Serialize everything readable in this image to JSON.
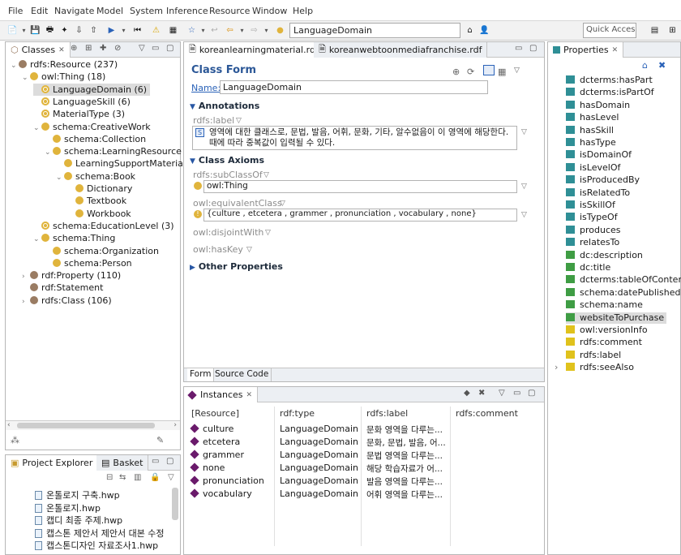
{
  "menu": [
    "File",
    "Edit",
    "Navigate",
    "Model",
    "System",
    "Inference",
    "Resource",
    "Window",
    "Help"
  ],
  "toolbar": {
    "current_resource": "LanguageDomain",
    "quick_access": "Quick Access"
  },
  "classes": {
    "tab": "Classes",
    "tree": [
      {
        "label": "rdfs:Resource  (237)",
        "indent": 0,
        "twisty": "v",
        "icon": "brown"
      },
      {
        "label": "owl:Thing  (18)",
        "indent": 1,
        "twisty": "v",
        "icon": "yellow"
      },
      {
        "label": "LanguageDomain  (6)",
        "indent": 2,
        "twisty": "",
        "icon": "ring",
        "selected": true
      },
      {
        "label": "LanguageSkill  (6)",
        "indent": 2,
        "twisty": "",
        "icon": "ring"
      },
      {
        "label": "MaterialType  (3)",
        "indent": 2,
        "twisty": "",
        "icon": "ring"
      },
      {
        "label": "schema:CreativeWork",
        "indent": 2,
        "twisty": "v",
        "icon": "yellow"
      },
      {
        "label": "schema:Collection",
        "indent": 3,
        "twisty": "",
        "icon": "yellow"
      },
      {
        "label": "schema:LearningResource",
        "indent": 3,
        "twisty": "v",
        "icon": "yellow"
      },
      {
        "label": "LearningSupportMaterial",
        "indent": 4,
        "twisty": "",
        "icon": "yellow"
      },
      {
        "label": "schema:Book",
        "indent": 4,
        "twisty": "v",
        "icon": "yellow"
      },
      {
        "label": "Dictionary",
        "indent": 5,
        "twisty": "",
        "icon": "yellow"
      },
      {
        "label": "Textbook",
        "indent": 5,
        "twisty": "",
        "icon": "yellow"
      },
      {
        "label": "Workbook",
        "indent": 5,
        "twisty": "",
        "icon": "yellow"
      },
      {
        "label": "schema:EducationLevel  (3)",
        "indent": 2,
        "twisty": "",
        "icon": "ring"
      },
      {
        "label": "schema:Thing",
        "indent": 2,
        "twisty": "v",
        "icon": "yellow"
      },
      {
        "label": "schema:Organization",
        "indent": 3,
        "twisty": "",
        "icon": "yellow"
      },
      {
        "label": "schema:Person",
        "indent": 3,
        "twisty": "",
        "icon": "yellow"
      },
      {
        "label": "rdf:Property  (110)",
        "indent": 1,
        "twisty": ">",
        "icon": "brown"
      },
      {
        "label": "rdf:Statement",
        "indent": 1,
        "twisty": "",
        "icon": "brown"
      },
      {
        "label": "rdfs:Class  (106)",
        "indent": 1,
        "twisty": ">",
        "icon": "brown"
      }
    ]
  },
  "project": {
    "tab": "Project Explorer",
    "tab2": "Basket",
    "files": [
      "온톨로지 구축.hwp",
      "온톨로지.hwp",
      "캡디 최종 주제.hwp",
      "캡스톤 제안서 제안서 대본 수정",
      "캡스톤디자인 자료조사1.hwp"
    ]
  },
  "editor_tabs": [
    "koreanlearningmaterial.rdf",
    "koreanwebtoonmediafranchise.rdf"
  ],
  "form": {
    "title": "Class Form",
    "name_label": "Name:",
    "name_value": "LanguageDomain",
    "annotations": "Annotations",
    "rdfs_label": "rdfs:label",
    "label_text_1": "영역에 대한 클래스로, 문법, 발음, 어휘, 문화, 기타, 알수없음이 이 영역에 해당한다.",
    "label_text_2": "때에 따라 중복값이 입력될 수 있다.",
    "lang_badge": "S",
    "axioms": "Class Axioms",
    "subclassof": "rdfs:subClassOf",
    "subclass_value": "owl:Thing",
    "equivalent": "owl:equivalentClass",
    "equivalent_value": "{culture , etcetera , grammer , pronunciation , vocabulary , none}",
    "disjoint": "owl:disjointWith",
    "haskey": "owl:hasKey",
    "other": "Other Properties",
    "bottom_tabs": [
      "Form",
      "Source Code"
    ]
  },
  "instances": {
    "tab": "Instances",
    "columns": [
      "[Resource]",
      "rdf:type",
      "rdfs:label",
      "rdfs:comment"
    ],
    "rows": [
      {
        "name": "culture",
        "type": "LanguageDomain",
        "label": "문화 영역을 다루는..."
      },
      {
        "name": "etcetera",
        "type": "LanguageDomain",
        "label": "문화, 문법, 발음, 어..."
      },
      {
        "name": "grammer",
        "type": "LanguageDomain",
        "label": "문법 영역을 다루는..."
      },
      {
        "name": "none",
        "type": "LanguageDomain",
        "label": "해당 학습자료가 어..."
      },
      {
        "name": "pronunciation",
        "type": "LanguageDomain",
        "label": "발음 영역을 다루는..."
      },
      {
        "name": "vocabulary",
        "type": "LanguageDomain",
        "label": "어휘 영역을 다루는..."
      }
    ]
  },
  "properties": {
    "tab": "Properties",
    "items": [
      {
        "label": "dcterms:hasPart",
        "kind": "teal"
      },
      {
        "label": "dcterms:isPartOf",
        "kind": "teal"
      },
      {
        "label": "hasDomain",
        "kind": "teal"
      },
      {
        "label": "hasLevel",
        "kind": "teal"
      },
      {
        "label": "hasSkill",
        "kind": "teal"
      },
      {
        "label": "hasType",
        "kind": "teal"
      },
      {
        "label": "isDomainOf",
        "kind": "teal"
      },
      {
        "label": "isLevelOf",
        "kind": "teal"
      },
      {
        "label": "isProducedBy",
        "kind": "teal"
      },
      {
        "label": "isRelatedTo",
        "kind": "teal"
      },
      {
        "label": "isSkillOf",
        "kind": "teal"
      },
      {
        "label": "isTypeOf",
        "kind": "teal"
      },
      {
        "label": "produces",
        "kind": "teal"
      },
      {
        "label": "relatesTo",
        "kind": "teal"
      },
      {
        "label": "dc:description",
        "kind": "green"
      },
      {
        "label": "dc:title",
        "kind": "green"
      },
      {
        "label": "dcterms:tableOfContents",
        "kind": "green"
      },
      {
        "label": "schema:datePublished",
        "kind": "green"
      },
      {
        "label": "schema:name",
        "kind": "green"
      },
      {
        "label": "websiteToPurchase",
        "kind": "green",
        "selected": true
      },
      {
        "label": "owl:versionInfo",
        "kind": "yellow"
      },
      {
        "label": "rdfs:comment",
        "kind": "yellow"
      },
      {
        "label": "rdfs:label",
        "kind": "yellow"
      },
      {
        "label": "rdfs:seeAlso",
        "kind": "yellow",
        "twisty": ">"
      }
    ]
  }
}
